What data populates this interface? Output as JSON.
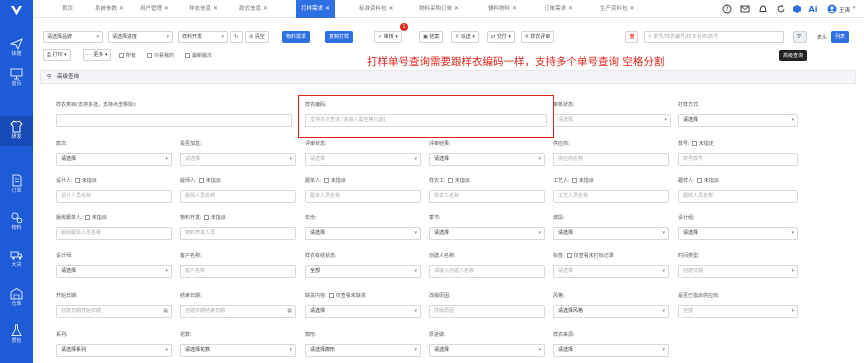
{
  "sidebar": {
    "items": [
      {
        "label": "快捷",
        "icon": "paper-plane-icon"
      },
      {
        "label": "首页",
        "icon": "monitor-icon"
      },
      {
        "label": "研发",
        "icon": "shirt-icon"
      },
      {
        "label": "订单",
        "icon": "document-icon"
      },
      {
        "label": "物料",
        "icon": "gears-icon"
      },
      {
        "label": "大货",
        "icon": "truck-icon"
      },
      {
        "label": "仓库",
        "icon": "warehouse-icon"
      },
      {
        "label": "质检",
        "icon": "flask-icon"
      }
    ]
  },
  "tabs": [
    {
      "label": "首页",
      "closable": false
    },
    {
      "label": "系统参数",
      "closable": true
    },
    {
      "label": "用户管理",
      "closable": true
    },
    {
      "label": "样衣信息",
      "closable": true
    },
    {
      "label": "款式信息",
      "closable": true
    },
    {
      "label": "打样需求",
      "closable": true,
      "active": true
    },
    {
      "label": "标准资料包",
      "closable": true
    },
    {
      "label": "物料采购订单",
      "closable": true
    },
    {
      "label": "辅料物料",
      "closable": true
    },
    {
      "label": "订单需求",
      "closable": true
    },
    {
      "label": "生产资料包",
      "closable": true
    }
  ],
  "user": {
    "name": "王涛"
  },
  "toolbar": {
    "sel_kind": "请选择品牌",
    "sel_season": "请选择进度",
    "sel_dev": "样料开发",
    "reset": "⊘ 清空",
    "btn_material": "物料需求",
    "btn_copy": "复制打样",
    "btn_audit": "审核",
    "btn_archive": "结案",
    "btn_dispatch": "派送",
    "btn_deliver": "交付",
    "btn_design": "样衣评审",
    "badge": "1",
    "print": "⎙ 打印",
    "more": "··· 更多",
    "chk_all": "所有",
    "chk_mine": "只看我的",
    "chk_latest": "最新版次",
    "search_placeholder": "单号/样衣编号/样衣名称/款号",
    "col_label": "表头",
    "list_label": "列表"
  },
  "tooltip": "高级查询",
  "annotation": "打样单号查询需要跟样衣编码一样，支持多个单号查询 空格分割",
  "adv_title": "高级查询",
  "form": {
    "r1": [
      {
        "label": "样衣类目(支持多选，支持点击移除):",
        "value": ""
      },
      {
        "label": "样衣编码:",
        "value": "支持多次查询 (多输入需空格分割)",
        "ph": true
      },
      {
        "label": "审核状态:",
        "value": "请选择"
      },
      {
        "label": "打样方式:",
        "value": "请选择",
        "val": true
      }
    ],
    "r2": [
      {
        "label": "款次:",
        "value": "请选择",
        "val": true
      },
      {
        "label": "是否加急:",
        "value": "请选择"
      },
      {
        "label": "评审状态:",
        "value": "请选择"
      },
      {
        "label": "评审结果:",
        "value": "请选择",
        "val": true
      },
      {
        "label": "供应商:",
        "value": "供应商名称"
      },
      {
        "label": "款号:",
        "value": "款号款号",
        "chk": "未指定"
      }
    ],
    "r3": [
      {
        "label": "设计人:",
        "chk": "未指派",
        "value": "设计人员名称"
      },
      {
        "label": "版师人:",
        "chk": "未指派",
        "value": "版师人员名称"
      },
      {
        "label": "跟单人:",
        "chk": "未指派",
        "value": "跟单人员名称"
      },
      {
        "label": "样衣工:",
        "chk": "未指派",
        "value": "样衣工名称"
      },
      {
        "label": "工艺人:",
        "chk": "未指派",
        "value": "工艺人员名称"
      },
      {
        "label": "跟样人:",
        "chk": "未指派",
        "value": "跟样人员名称"
      }
    ],
    "r4": [
      {
        "label": "版房跟单人:",
        "chk": "未指派",
        "value": "版房跟单人员名称"
      },
      {
        "label": "物料开发:",
        "chk": "未指派",
        "value": "物料开发人员"
      },
      {
        "label": "年份:",
        "value": "请选择",
        "val": true
      },
      {
        "label": "季节:",
        "value": "请选择",
        "val": true
      },
      {
        "label": "波段:",
        "value": "请选择",
        "val": true
      },
      {
        "label": "设计组:",
        "value": "请选择",
        "val": true
      }
    ],
    "r5": [
      {
        "label": "设计师:",
        "value": "请选择",
        "val": true
      },
      {
        "label": "客户名称:",
        "value": "客户名称"
      },
      {
        "label": "样衣有结状态:",
        "value": "全部",
        "val": true
      },
      {
        "label": "创建人名称:",
        "value": "请输入创建人名称"
      },
      {
        "label": "标签:",
        "chk": "仅查看未打标记录",
        "value": "请选择"
      },
      {
        "label": "时间类型:",
        "value": "创建日期"
      }
    ],
    "r6": [
      {
        "label": "开始日期:",
        "value": "创建日期开始日期"
      },
      {
        "label": "结束日期:",
        "value": "创建日期结束日期"
      },
      {
        "label": "缺货内容:",
        "chk": "仅查看未缺货",
        "value": "请选择",
        "val": true
      },
      {
        "label": "改版原因:",
        "value": "改版原因"
      },
      {
        "label": "风格:",
        "value": "请选择风格",
        "val": true
      },
      {
        "label": "是否已指派供应商:",
        "value": "全部"
      }
    ],
    "r7": [
      {
        "label": "系列:",
        "value": "请选择系列",
        "val": true
      },
      {
        "label": "花数:",
        "value": "请选择花数",
        "val": true
      },
      {
        "label": "廓形:",
        "value": "请选择廓形",
        "val": true
      },
      {
        "label": "厚进做:",
        "value": "请选择",
        "val": true
      },
      {
        "label": "样衣来源:",
        "value": "请选择",
        "val": true
      }
    ]
  }
}
